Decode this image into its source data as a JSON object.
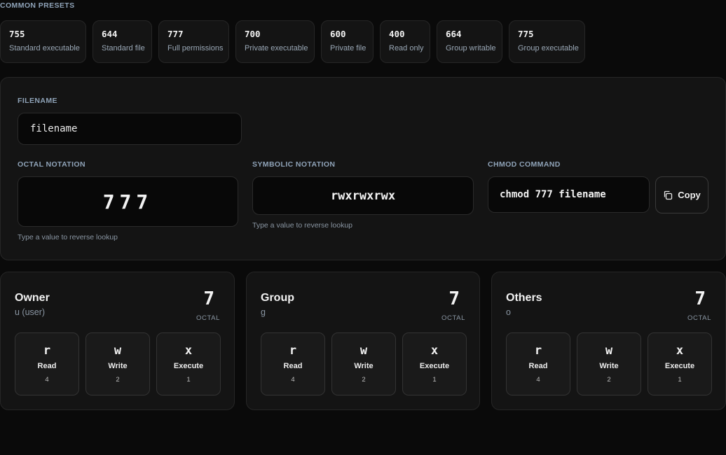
{
  "presets": {
    "label": "COMMON PRESETS",
    "items": [
      {
        "code": "755",
        "desc": "Standard executable"
      },
      {
        "code": "644",
        "desc": "Standard file"
      },
      {
        "code": "777",
        "desc": "Full permissions"
      },
      {
        "code": "700",
        "desc": "Private executable"
      },
      {
        "code": "600",
        "desc": "Private file"
      },
      {
        "code": "400",
        "desc": "Read only"
      },
      {
        "code": "664",
        "desc": "Group writable"
      },
      {
        "code": "775",
        "desc": "Group executable"
      }
    ]
  },
  "filename": {
    "label": "FILENAME",
    "value": "filename"
  },
  "octal": {
    "label": "OCTAL NOTATION",
    "value": "777",
    "hint": "Type a value to reverse lookup"
  },
  "symbolic": {
    "label": "SYMBOLIC NOTATION",
    "value": "rwxrwxrwx",
    "hint": "Type a value to reverse lookup"
  },
  "command": {
    "label": "CHMOD COMMAND",
    "value": "chmod 777 filename",
    "copy_label": "Copy"
  },
  "groups": [
    {
      "title": "Owner",
      "sub": "u (user)",
      "octal": "7",
      "octal_label": "OCTAL",
      "bits": [
        {
          "sym": "r",
          "name": "Read",
          "val": "4"
        },
        {
          "sym": "w",
          "name": "Write",
          "val": "2"
        },
        {
          "sym": "x",
          "name": "Execute",
          "val": "1"
        }
      ]
    },
    {
      "title": "Group",
      "sub": "g",
      "octal": "7",
      "octal_label": "OCTAL",
      "bits": [
        {
          "sym": "r",
          "name": "Read",
          "val": "4"
        },
        {
          "sym": "w",
          "name": "Write",
          "val": "2"
        },
        {
          "sym": "x",
          "name": "Execute",
          "val": "1"
        }
      ]
    },
    {
      "title": "Others",
      "sub": "o",
      "octal": "7",
      "octal_label": "OCTAL",
      "bits": [
        {
          "sym": "r",
          "name": "Read",
          "val": "4"
        },
        {
          "sym": "w",
          "name": "Write",
          "val": "2"
        },
        {
          "sym": "x",
          "name": "Execute",
          "val": "1"
        }
      ]
    }
  ]
}
